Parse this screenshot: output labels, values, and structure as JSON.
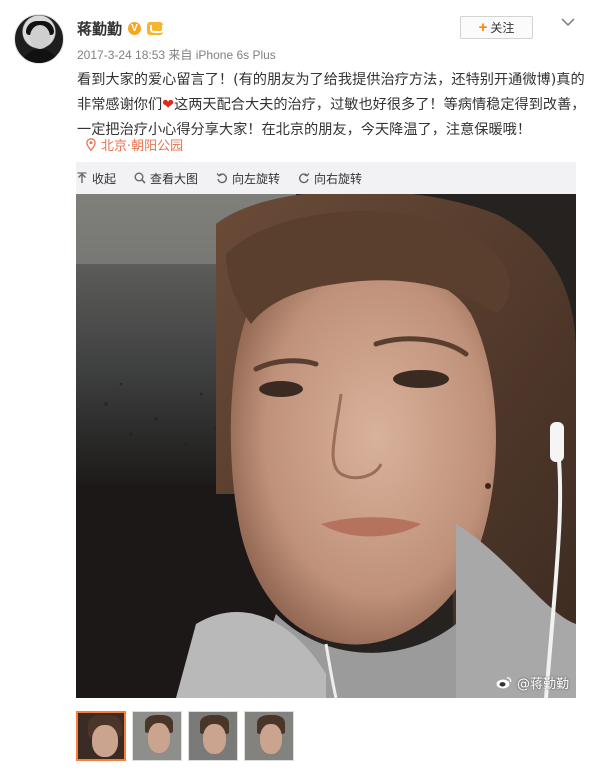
{
  "user": {
    "name": "蒋勤勤",
    "verified_badge": "V",
    "timestamp": "2017-3-24 18:53",
    "source": "来自 iPhone 6s Plus"
  },
  "follow_button": {
    "plus": "+",
    "label": "关注"
  },
  "post": {
    "text_part1": "看到大家的爱心留言了！(有的朋友为了给我提供治疗方法，还特别开通微博)真的非常感谢你们",
    "heart": "❤",
    "text_part2": "这两天配合大夫的治疗，过敏也好很多了！等病情稳定得到改善，一定把治疗小心得分享大家！在北京的朋友，今天降温了，注意保暖哦！"
  },
  "location": {
    "label": "北京·朝阳公园"
  },
  "toolbar": {
    "collapse": "收起",
    "view_large": "查看大图",
    "rotate_left": "向左旋转",
    "rotate_right": "向右旋转"
  },
  "photo": {
    "watermark": "@蒋勤勤"
  },
  "thumbnails": {
    "count": 4,
    "selected_index": 0
  },
  "colors": {
    "accent": "#ff8200",
    "location": "#eb7350",
    "toolbar_bg": "#f2f2f5",
    "heart": "#e0281b"
  }
}
